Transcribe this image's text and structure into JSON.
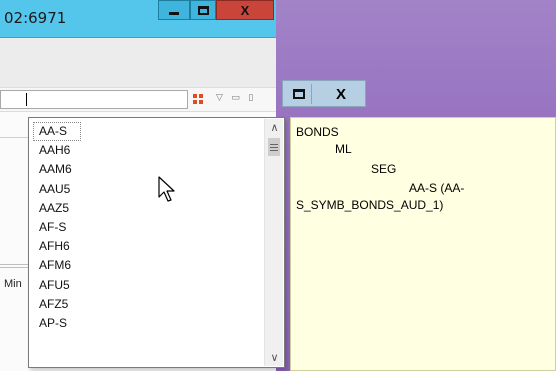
{
  "back_window": {
    "title": "02:6971",
    "min_label": "Min"
  },
  "second_window": {
    "close_label": "X"
  },
  "dropdown": {
    "items": [
      "AA-S",
      "AAH6",
      "AAM6",
      "AAU5",
      "AAZ5",
      "AF-S",
      "AFH6",
      "AFM6",
      "AFU5",
      "AFZ5",
      "AP-S"
    ],
    "selected": "AA-S",
    "scroll_up": "∧",
    "scroll_down": "∨"
  },
  "info_panel": {
    "lines": [
      "BONDS",
      "ML",
      "SEG",
      "AA-S (AA-",
      "S_SYMB_BONDS_AUD_1)"
    ]
  },
  "colors": {
    "title_bar": "#54c6ec",
    "close_button": "#c9453a",
    "desktop": "#9670bf",
    "info_background": "#ffffe1"
  },
  "icons": [
    "minimize-icon",
    "maximize-icon",
    "close-icon",
    "grid-icon",
    "scroll-up-icon",
    "scroll-down-icon",
    "mouse-cursor-icon"
  ]
}
